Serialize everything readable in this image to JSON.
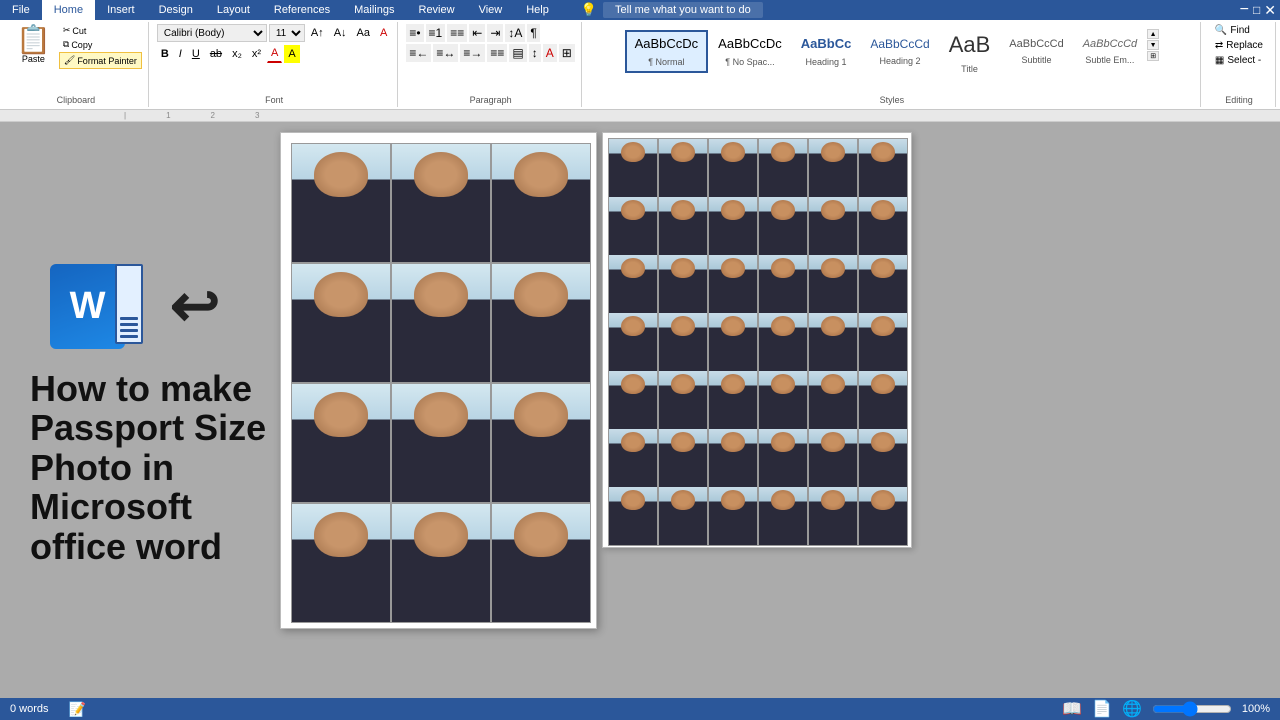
{
  "tabs": {
    "items": [
      "File",
      "Home",
      "Insert",
      "Design",
      "Layout",
      "References",
      "Mailings",
      "Review",
      "View",
      "Help"
    ],
    "active": "Home"
  },
  "ribbon": {
    "clipboard": {
      "label": "Clipboard",
      "paste": "Paste",
      "cut": "Cut",
      "copy": "Copy",
      "format_painter": "Format Painter"
    },
    "font": {
      "label": "Font",
      "family": "Calibri (Body)",
      "size": "11",
      "bold": "B",
      "italic": "I",
      "underline": "U",
      "strikethrough": "ab",
      "subscript": "x₂",
      "superscript": "x²"
    },
    "paragraph": {
      "label": "Paragraph"
    },
    "styles": {
      "label": "Styles",
      "items": [
        {
          "name": "Normal",
          "preview": "AaBbCcDc",
          "sub": "¶ Normal",
          "active": true
        },
        {
          "name": "No Spacing",
          "preview": "AaBbCcDc",
          "sub": "¶ No Spac...",
          "active": false
        },
        {
          "name": "Heading 1",
          "preview": "AaBbCc",
          "sub": "Heading 1",
          "active": false
        },
        {
          "name": "Heading 2",
          "preview": "AaBbCcCd",
          "sub": "Heading 2",
          "active": false
        },
        {
          "name": "Title",
          "preview": "AaB",
          "sub": "Title",
          "active": false
        },
        {
          "name": "Subtitle",
          "preview": "AaBbCcCd",
          "sub": "Subtitle",
          "active": false
        },
        {
          "name": "Subtle Em.",
          "preview": "AaBbCcCd",
          "sub": "Subtle Em...",
          "active": false
        }
      ]
    },
    "editing": {
      "label": "Editing",
      "find": "Find",
      "replace": "Replace",
      "select": "Select -"
    }
  },
  "tutorial": {
    "title_line1": "How to make",
    "title_line2": "Passport Size",
    "title_line3": "Photo in",
    "title_line4": "Microsoft",
    "title_line5": "office word"
  },
  "status_bar": {
    "words": "0 words",
    "zoom": "100%"
  },
  "lightbulb_placeholder": "Tell me what you want to do"
}
